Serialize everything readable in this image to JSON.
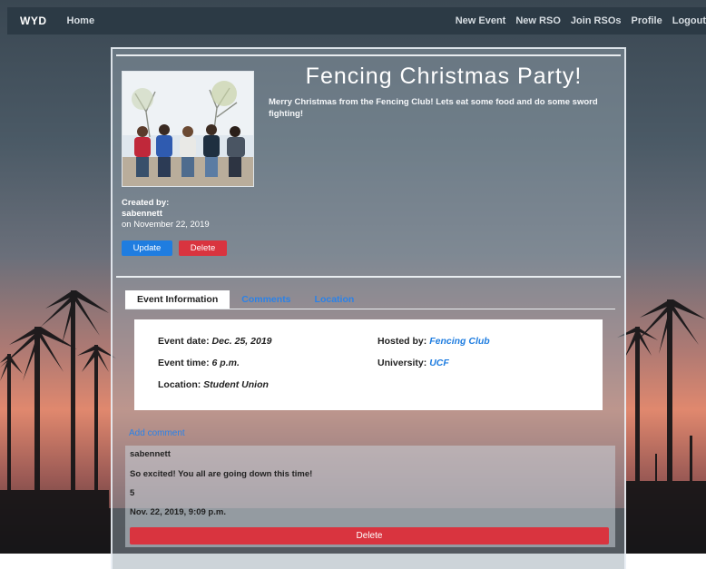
{
  "navbar": {
    "brand": "WYD",
    "home": "Home",
    "links": [
      "New Event",
      "New RSO",
      "Join RSOs",
      "Profile",
      "Logout"
    ]
  },
  "event": {
    "title": "Fencing Christmas Party!",
    "description": "Merry Christmas from the Fencing Club! Lets eat some food and do some sword fighting!",
    "created_by_label": "Created by:",
    "created_by": "sabennett",
    "created_on": "on November 22, 2019",
    "update_label": "Update",
    "delete_label": "Delete"
  },
  "tabs": [
    "Event Information",
    "Comments",
    "Location"
  ],
  "info": {
    "date_label": "Event date:",
    "date": "Dec. 25, 2019",
    "time_label": "Event time:",
    "time": "6 p.m.",
    "location_label": "Location:",
    "location": "Student Union",
    "hosted_label": "Hosted by:",
    "hosted": "Fencing Club",
    "university_label": "University:",
    "university": "UCF"
  },
  "add_comment": "Add comment",
  "comment": {
    "author": "sabennett",
    "text": "So excited! You all are going down this time!",
    "rating": "5",
    "timestamp": "Nov. 22, 2019, 9:09 p.m.",
    "delete_label": "Delete"
  },
  "colors": {
    "primary": "#1f7de0",
    "danger": "#d9343f",
    "navbar": "#2c3a45"
  }
}
